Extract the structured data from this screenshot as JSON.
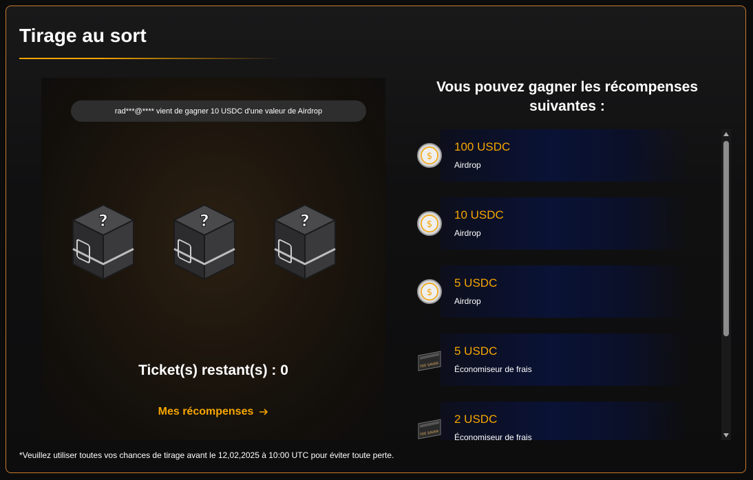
{
  "page": {
    "title": "Tirage au sort",
    "accent_color": "#f7a600"
  },
  "draw": {
    "winner_ticker": "rad***@**** vient de gagner 10 USDC d'une valeur de Airdrop",
    "box_icon": "mystery-box-icon",
    "box_count": 3,
    "tickets_label": "Ticket(s) restant(s) : 0",
    "my_rewards_label": "Mes récompenses",
    "my_rewards_icon": "arrow-right-icon"
  },
  "rewards": {
    "heading": "Vous pouvez gagner les récompenses suivantes :",
    "items": [
      {
        "amount": "100 USDC",
        "type": "Airdrop",
        "icon": "usdc-coin-icon"
      },
      {
        "amount": "10 USDC",
        "type": "Airdrop",
        "icon": "usdc-coin-icon"
      },
      {
        "amount": "5 USDC",
        "type": "Airdrop",
        "icon": "usdc-coin-icon"
      },
      {
        "amount": "5 USDC",
        "type": "Économiseur de frais",
        "icon": "fee-saver-icon"
      },
      {
        "amount": "2 USDC",
        "type": "Économiseur de frais",
        "icon": "fee-saver-icon"
      }
    ]
  },
  "footnote": "*Veuillez utiliser toutes vos chances de tirage avant le 12,02,2025 à 10:00 UTC pour éviter toute perte."
}
